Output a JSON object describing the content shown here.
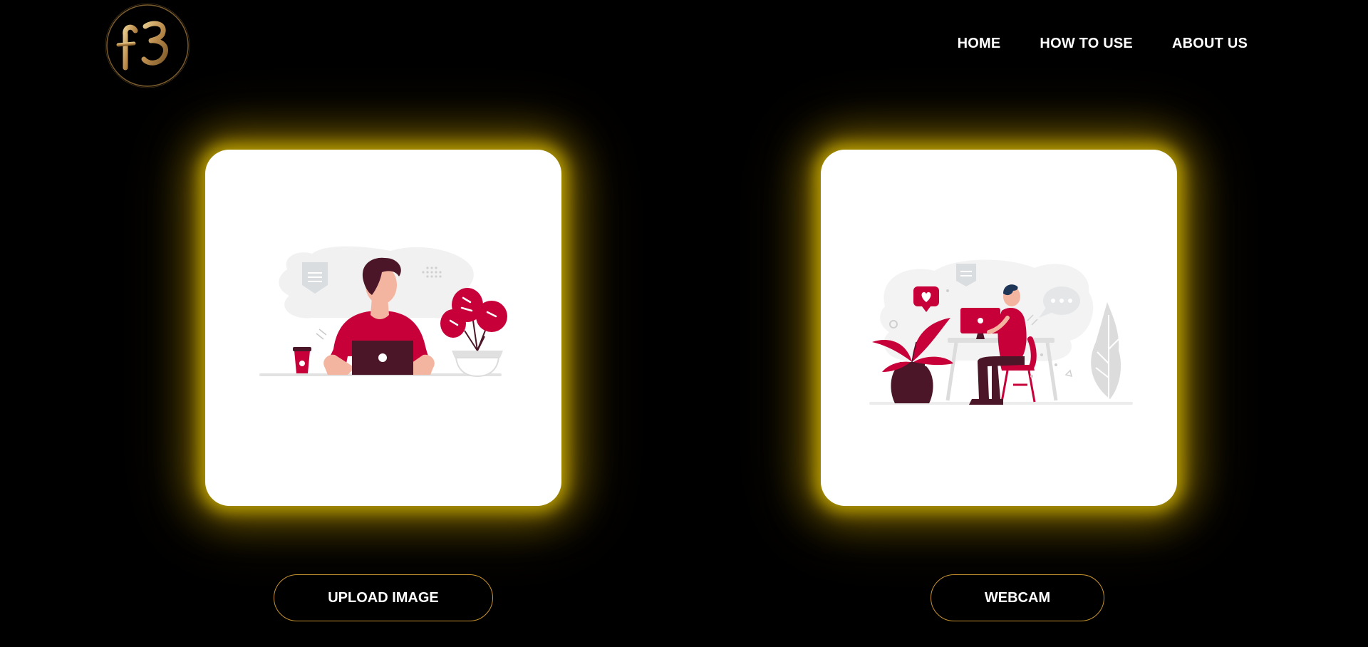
{
  "logo": {
    "text": "f3",
    "icon": "f3-logo-icon",
    "colors": {
      "gold": "#c9a15a",
      "ring": "#8a6a35"
    }
  },
  "nav": {
    "items": [
      {
        "label": "HOME"
      },
      {
        "label": "HOW TO USE"
      },
      {
        "label": "ABOUT US"
      }
    ]
  },
  "cards": [
    {
      "illustration": "person-with-laptop-illustration",
      "button_label": "UPLOAD IMAGE"
    },
    {
      "illustration": "person-at-computer-desk-illustration",
      "button_label": "WEBCAM"
    }
  ],
  "colors": {
    "background": "#000000",
    "card": "#ffffff",
    "glow": "#b49a00",
    "button_border": "#c8932e",
    "accent_red": "#c8003a",
    "dark_maroon": "#4a1628",
    "skin": "#f4b5a0",
    "light_gray": "#e6e6e6"
  }
}
